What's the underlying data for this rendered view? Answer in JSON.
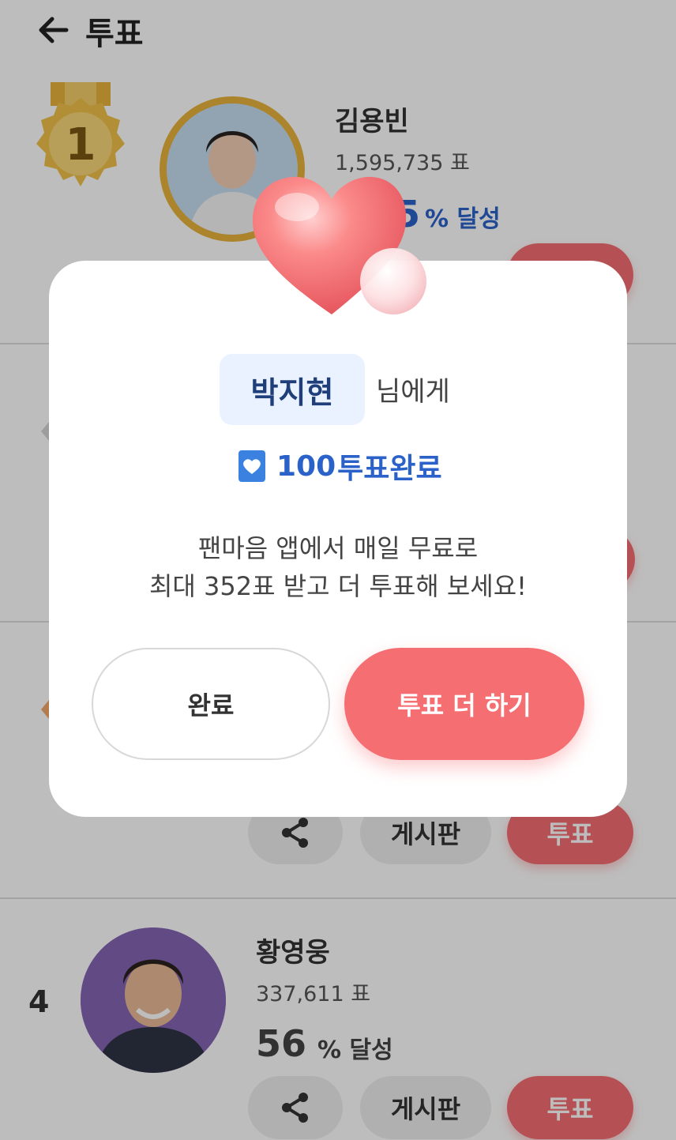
{
  "header": {
    "title": "투표"
  },
  "ranking": [
    {
      "rank": "1",
      "name": "김용빈",
      "votes": "1,595,735 표",
      "percent": "5",
      "percent_label": "% 달성"
    },
    {
      "rank": "4",
      "name": "황영웅",
      "votes": "337,611 표",
      "percent": "56",
      "percent_label": "% 달성",
      "share_label": "",
      "board_label": "게시판",
      "vote_label": "투표"
    }
  ],
  "row3": {
    "board_label": "게시판",
    "vote_label": "투표"
  },
  "modal": {
    "recipient": "박지현",
    "recipient_suffix": "님에게",
    "vote_count": "100",
    "vote_done_label": "투표완료",
    "message_line1": "팬마음 앱에서 매일 무료로",
    "message_line2": "최대 352표 받고 더 투표해 보세요!",
    "done_button": "완료",
    "more_button": "투표 더 하기"
  },
  "icons": {
    "back": "arrow-left-icon",
    "share": "share-icon",
    "heart": "heart-icon",
    "medal": "gold-medal-icon"
  },
  "colors": {
    "accent_red": "#f56e72",
    "accent_blue": "#2a62c9",
    "medal_gold": "#e8b23a"
  }
}
